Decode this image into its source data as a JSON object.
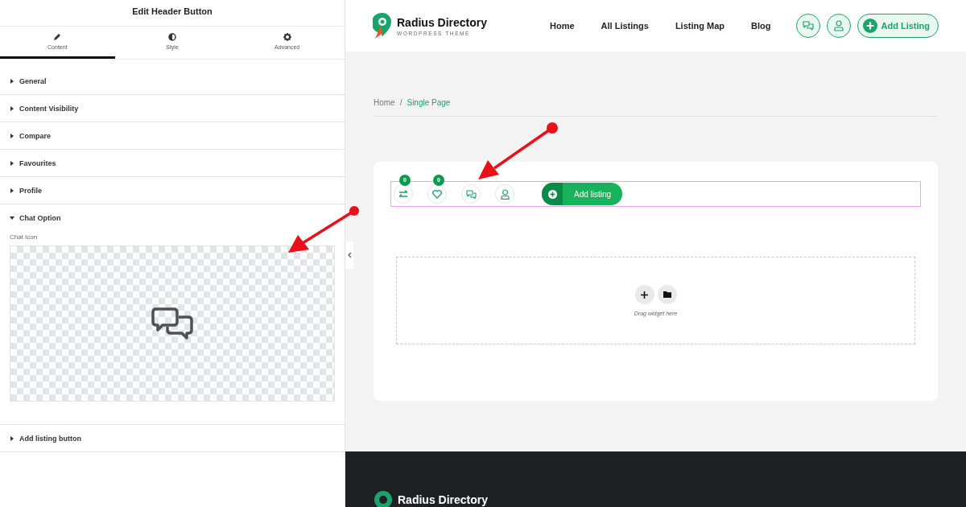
{
  "panel": {
    "title": "Edit Header Button",
    "tabs": [
      {
        "label": "Content",
        "kind": "pencil",
        "selected": true
      },
      {
        "label": "Style",
        "kind": "contrast",
        "selected": false
      },
      {
        "label": "Advanced",
        "kind": "gear",
        "selected": false
      }
    ],
    "sections": [
      {
        "label": "General",
        "expanded": false
      },
      {
        "label": "Content Visibility",
        "expanded": false
      },
      {
        "label": "Compare",
        "expanded": false
      },
      {
        "label": "Favourites",
        "expanded": false
      },
      {
        "label": "Profile",
        "expanded": false
      },
      {
        "label": "Chat Option",
        "expanded": true,
        "field_label": "Chat Icon"
      },
      {
        "label": "Add listing button",
        "expanded": false
      }
    ]
  },
  "site": {
    "logo_name": "Radius Directory",
    "logo_tagline": "WORDPRESS THEME",
    "nav": [
      "Home",
      "All Listings",
      "Listing Map",
      "Blog"
    ],
    "add_button": "Add Listing"
  },
  "breadcrumb": {
    "items": [
      {
        "label": "Home",
        "current": false
      },
      {
        "label": "Single Page",
        "current": true
      }
    ],
    "separator": "/"
  },
  "widget": {
    "icons": [
      {
        "kind": "compare",
        "badge": "0"
      },
      {
        "kind": "favourite",
        "badge": "0"
      },
      {
        "kind": "chat"
      },
      {
        "kind": "profile"
      }
    ],
    "add_button": "Add listing"
  },
  "drop_zone": {
    "hint": "Drag widget here"
  },
  "footer": {
    "logo_name": "Radius Directory"
  }
}
